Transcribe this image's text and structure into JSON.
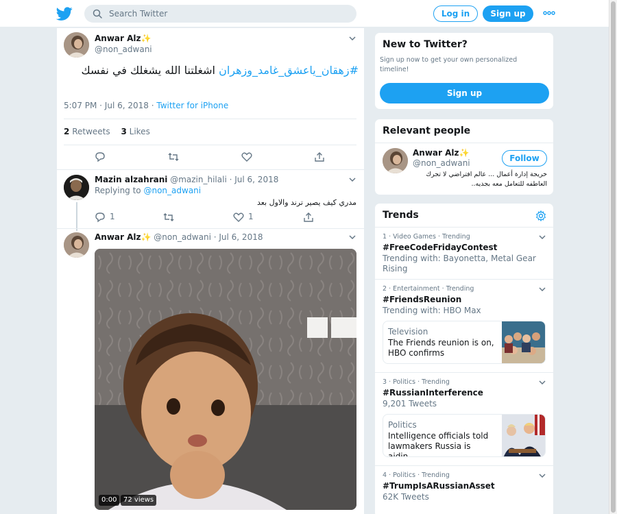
{
  "search": {
    "placeholder": "Search Twitter"
  },
  "header": {
    "login_label": "Log in",
    "signup_label": "Sign up"
  },
  "tweet": {
    "author_name": "Anwar Alz✨",
    "author_handle": "@non_adwani",
    "text_hashtag": "#زهقان_ياعشق_غامد_وزهران",
    "text_body": " اشغلتنا الله يشغلك في نفسك",
    "time": "5:07 PM · Jul 6, 2018",
    "source": "Twitter for iPhone",
    "retweets_count": "2",
    "retweets_label": "Retweets",
    "likes_count": "3",
    "likes_label": "Likes"
  },
  "reply": {
    "author_name": "Mazin alzahrani",
    "author_handle": "@mazin_hilali",
    "date": "Jul 6, 2018",
    "replying_to_label": "Replying to",
    "replying_to_handle": "@non_adwani",
    "text": "مدري كيف يصير ترند والاول بعد",
    "reply_count": "1",
    "like_count": "1"
  },
  "thread_tweet": {
    "author_name": "Anwar Alz✨",
    "author_handle": "@non_adwani",
    "date": "Jul 6, 2018",
    "video_time": "0:00",
    "video_views": "72 views"
  },
  "new_to_twitter": {
    "title": "New to Twitter?",
    "description": "Sign up now to get your own personalized timeline!",
    "signup_label": "Sign up"
  },
  "relevant_people": {
    "title": "Relevant people",
    "name": "Anwar Alz✨",
    "handle": "@non_adwani",
    "follow_label": "Follow",
    "bio": "خريجة إدارة أعمال ... عالم افتراضي لا تجرك العاطفه للتعامل معه بجديه.."
  },
  "trends": {
    "title": "Trends",
    "items": [
      {
        "meta": "1 · Video Games · Trending",
        "name": "#FreeCodeFridayContest",
        "sub": "Trending with: Bayonetta, Metal Gear Rising"
      },
      {
        "meta": "2 · Entertainment · Trending",
        "name": "#FriendsReunion",
        "sub": "Trending with: HBO Max",
        "news_category": "Television",
        "news_headline": "The Friends reunion is on, HBO confirms"
      },
      {
        "meta": "3 · Politics · Trending",
        "name": "#RussianInterference",
        "sub": "9,201 Tweets",
        "news_category": "Politics",
        "news_headline": "Intelligence officials told lawmakers Russia is aidin…"
      },
      {
        "meta": "4 · Politics · Trending",
        "name": "#TrumpIsARussianAsset",
        "sub": "62K Tweets"
      }
    ]
  },
  "colors": {
    "accent": "#1da1f2",
    "background": "#e6ecf0",
    "text": "#14171a",
    "muted": "#657786"
  }
}
